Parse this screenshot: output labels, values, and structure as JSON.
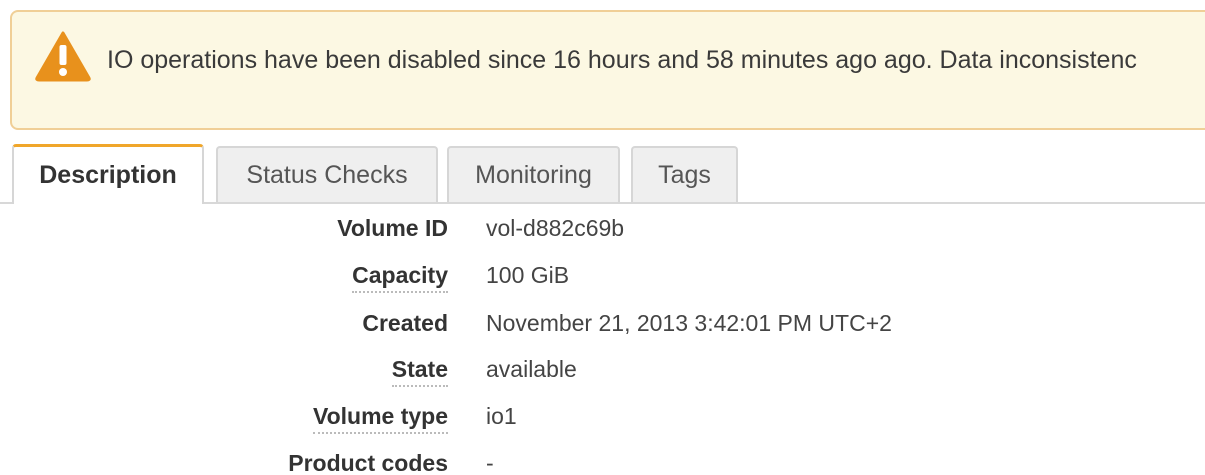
{
  "banner": {
    "icon": "warning-triangle-icon",
    "text": "IO operations have been disabled since 16 hours and 58 minutes ago ago. Data inconsistenc",
    "background": "#fcf8e3",
    "border": "#f0cf97",
    "icon_color": "#e8911c"
  },
  "tabs": [
    {
      "label": "Description",
      "active": true
    },
    {
      "label": "Status Checks",
      "active": false
    },
    {
      "label": "Monitoring",
      "active": false
    },
    {
      "label": "Tags",
      "active": false
    }
  ],
  "details": [
    {
      "label": "Volume ID",
      "value": "vol-d882c69b"
    },
    {
      "label": "Capacity",
      "value": "100 GiB"
    },
    {
      "label": "Created",
      "value": "November 21, 2013 3:42:01 PM UTC+2"
    },
    {
      "label": "State",
      "value": "available"
    },
    {
      "label": "Volume type",
      "value": "io1"
    },
    {
      "label": "Product codes",
      "value": "-"
    }
  ],
  "accent_color": "#f0a62a"
}
